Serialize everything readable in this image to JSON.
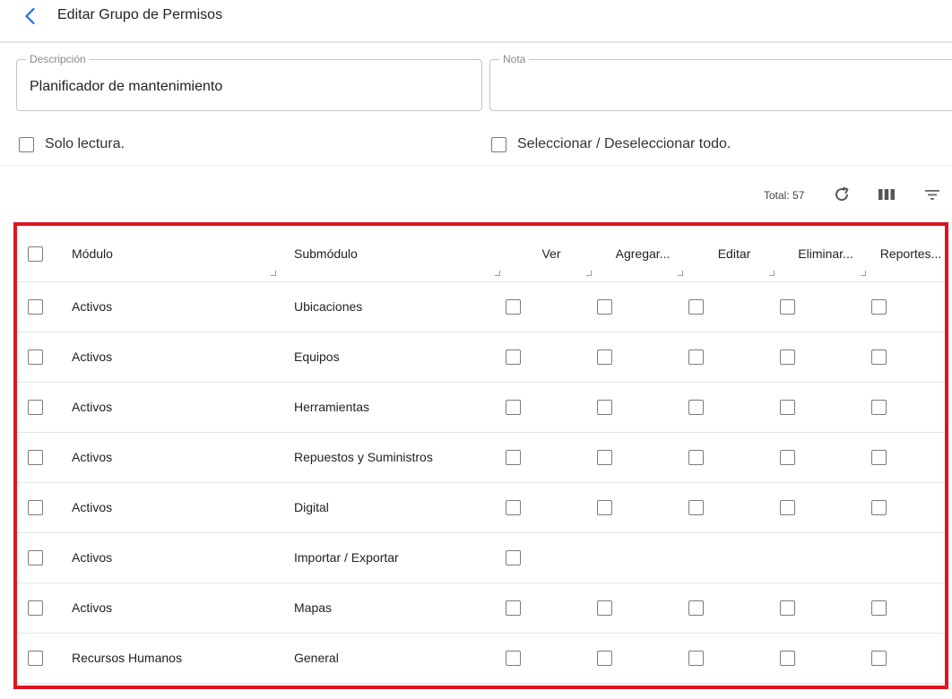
{
  "header": {
    "title": "Editar Grupo de Permisos",
    "back_icon": "chevron-left-icon"
  },
  "form": {
    "description": {
      "label": "Descripción",
      "value": "Planificador de mantenimiento"
    },
    "note": {
      "label": "Nota",
      "value": ""
    },
    "readonly": {
      "label": "Solo lectura.",
      "checked": false
    },
    "select_all": {
      "label": "Seleccionar / Deseleccionar todo.",
      "checked": false
    }
  },
  "toolbar": {
    "total_label": "Total: 57",
    "icons": [
      "refresh-icon",
      "columns-icon",
      "filter-icon"
    ]
  },
  "grid": {
    "columns": {
      "module": "Módulo",
      "submodule": "Submódulo",
      "view": "Ver",
      "add": "Agregar...",
      "edit": "Editar",
      "delete": "Eliminar...",
      "reports": "Reportes..."
    },
    "rows": [
      {
        "module": "Activos",
        "submodule": "Ubicaciones",
        "perms": [
          true,
          true,
          true,
          true,
          true
        ]
      },
      {
        "module": "Activos",
        "submodule": "Equipos",
        "perms": [
          true,
          true,
          true,
          true,
          true
        ]
      },
      {
        "module": "Activos",
        "submodule": "Herramientas",
        "perms": [
          true,
          true,
          true,
          true,
          true
        ]
      },
      {
        "module": "Activos",
        "submodule": "Repuestos y Suministros",
        "perms": [
          true,
          true,
          true,
          true,
          true
        ]
      },
      {
        "module": "Activos",
        "submodule": "Digital",
        "perms": [
          true,
          true,
          true,
          true,
          true
        ]
      },
      {
        "module": "Activos",
        "submodule": "Importar / Exportar",
        "perms": [
          true,
          false,
          false,
          false,
          false
        ]
      },
      {
        "module": "Activos",
        "submodule": "Mapas",
        "perms": [
          true,
          true,
          true,
          true,
          true
        ]
      },
      {
        "module": "Recursos Humanos",
        "submodule": "General",
        "perms": [
          true,
          true,
          true,
          true,
          true
        ]
      }
    ]
  },
  "colors": {
    "accent": "#1a73e8",
    "highlight_border": "#e0141e",
    "checkbox_border": "#7b7b7b"
  }
}
